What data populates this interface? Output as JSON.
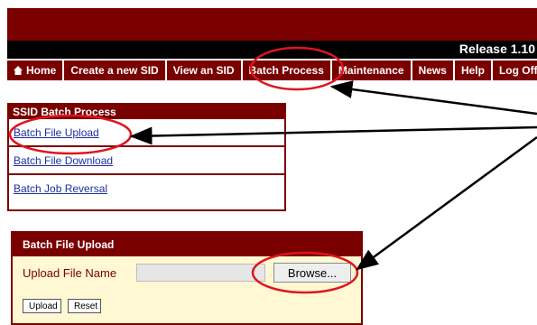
{
  "header": {
    "release": "Release 1.10"
  },
  "nav": {
    "items": [
      {
        "label": "Home",
        "icon": "home-icon"
      },
      {
        "label": "Create a new SID"
      },
      {
        "label": "View an SID"
      },
      {
        "label": "Batch Process"
      },
      {
        "label": "Maintenance"
      },
      {
        "label": "News"
      },
      {
        "label": "Help"
      },
      {
        "label": "Log Off"
      }
    ]
  },
  "batch_panel": {
    "title": "SSID Batch Process",
    "links": [
      "Batch File Upload",
      "Batch File Download",
      "Batch Job Reversal"
    ]
  },
  "upload_panel": {
    "title": "Batch File Upload",
    "field_label": "Upload File Name",
    "browse_label": "Browse...",
    "upload_label": "Upload",
    "reset_label": "Reset"
  },
  "colors": {
    "brand": "#7a0000",
    "annotation": "#e0141e",
    "link": "#1a2fa0",
    "panel_bg": "#fff8d2"
  }
}
